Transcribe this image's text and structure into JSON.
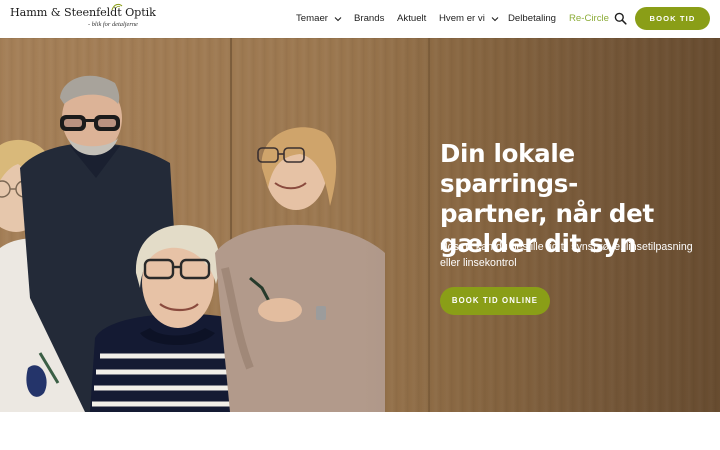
{
  "logo": {
    "name": "Hamm & Steenfeldt Optik",
    "tagline": "- blik for detaljerne"
  },
  "nav": {
    "items": [
      {
        "label": "Temaer",
        "has_dropdown": true
      },
      {
        "label": "Brands",
        "has_dropdown": false
      },
      {
        "label": "Aktuelt",
        "has_dropdown": false
      },
      {
        "label": "Hvem er vi",
        "has_dropdown": true
      },
      {
        "label": "Delbetaling",
        "has_dropdown": false
      },
      {
        "label": "Re-Circle",
        "has_dropdown": false
      }
    ],
    "search_icon": "search-icon",
    "book_label": "BOOK TID"
  },
  "hero": {
    "title_lines": [
      "Din lokale sparrings-",
      "partner, når det",
      "gælder dit syn"
    ],
    "subtitle": "Hos os kan du bestille tid til synsprøve, linsetilpasning eller linsekontrol",
    "cta_label": "BOOK TID ONLINE"
  },
  "colors": {
    "accent": "#8a9e17",
    "recircle": "#8dad3a",
    "hero_wood": "#9b774f"
  }
}
